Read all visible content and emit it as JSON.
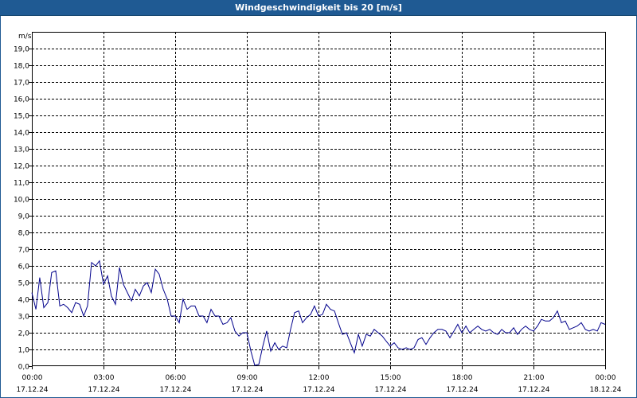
{
  "window": {
    "title": "Windgeschwindigkeit bis 20 [m/s]"
  },
  "chart_data": {
    "type": "line",
    "title": "Windgeschwindigkeit bis 20 [m/s]",
    "ylabel": "m/s",
    "xlabel": "",
    "ylim": [
      0,
      20
    ],
    "xlim_hours": [
      0,
      24
    ],
    "grid": true,
    "y_ticks": [
      "0,0",
      "1,0",
      "2,0",
      "3,0",
      "4,0",
      "5,0",
      "6,0",
      "7,0",
      "8,0",
      "9,0",
      "10,0",
      "11,0",
      "12,0",
      "13,0",
      "14,0",
      "15,0",
      "16,0",
      "17,0",
      "18,0",
      "19,0"
    ],
    "x_ticks": [
      {
        "time": "00:00",
        "date": "17.12.24"
      },
      {
        "time": "03:00",
        "date": "17.12.24"
      },
      {
        "time": "06:00",
        "date": "17.12.24"
      },
      {
        "time": "09:00",
        "date": "17.12.24"
      },
      {
        "time": "12:00",
        "date": "17.12.24"
      },
      {
        "time": "15:00",
        "date": "17.12.24"
      },
      {
        "time": "18:00",
        "date": "17.12.24"
      },
      {
        "time": "21:00",
        "date": "17.12.24"
      },
      {
        "time": "00:00",
        "date": "18.12.24"
      }
    ],
    "series": [
      {
        "color": "#00008b",
        "x_hours": [
          0.0,
          0.17,
          0.33,
          0.5,
          0.67,
          0.83,
          1.0,
          1.17,
          1.33,
          1.5,
          1.67,
          1.83,
          2.0,
          2.17,
          2.33,
          2.5,
          2.67,
          2.83,
          3.0,
          3.17,
          3.33,
          3.5,
          3.67,
          3.83,
          4.0,
          4.17,
          4.33,
          4.5,
          4.67,
          4.83,
          5.0,
          5.17,
          5.33,
          5.5,
          5.67,
          5.83,
          6.0,
          6.17,
          6.33,
          6.5,
          6.67,
          6.83,
          7.0,
          7.17,
          7.33,
          7.5,
          7.67,
          7.83,
          8.0,
          8.17,
          8.33,
          8.5,
          8.67,
          8.83,
          9.0,
          9.17,
          9.33,
          9.5,
          9.67,
          9.83,
          10.0,
          10.17,
          10.33,
          10.5,
          10.67,
          10.83,
          11.0,
          11.17,
          11.33,
          11.5,
          11.67,
          11.83,
          12.0,
          12.17,
          12.33,
          12.5,
          12.67,
          12.83,
          13.0,
          13.17,
          13.33,
          13.5,
          13.67,
          13.83,
          14.0,
          14.17,
          14.33,
          14.5,
          14.67,
          14.83,
          15.0,
          15.17,
          15.33,
          15.5,
          15.67,
          15.83,
          16.0,
          16.17,
          16.33,
          16.5,
          16.67,
          16.83,
          17.0,
          17.17,
          17.33,
          17.5,
          17.67,
          17.83,
          18.0,
          18.17,
          18.33,
          18.5,
          18.67,
          18.83,
          19.0,
          19.17,
          19.33,
          19.5,
          19.67,
          19.83,
          20.0,
          20.17,
          20.33,
          20.5,
          20.67,
          20.83,
          21.0,
          21.17,
          21.33,
          21.5,
          21.67,
          21.83,
          22.0,
          22.17,
          22.33,
          22.5,
          22.67,
          22.83,
          23.0,
          23.17,
          23.33,
          23.5,
          23.67,
          23.83,
          24.0
        ],
        "values": [
          4.4,
          3.4,
          5.3,
          3.5,
          3.8,
          5.6,
          5.7,
          3.6,
          3.7,
          3.5,
          3.2,
          3.8,
          3.7,
          3.0,
          3.6,
          6.2,
          6.0,
          6.3,
          4.9,
          5.4,
          4.2,
          3.7,
          5.9,
          4.9,
          4.4,
          3.9,
          4.6,
          4.2,
          4.8,
          5.0,
          4.4,
          5.8,
          5.5,
          4.6,
          4.0,
          3.0,
          3.0,
          2.6,
          4.0,
          3.4,
          3.6,
          3.6,
          3.0,
          3.0,
          2.6,
          3.4,
          3.0,
          3.0,
          2.5,
          2.6,
          2.9,
          2.1,
          1.8,
          2.0,
          2.0,
          0.9,
          0.05,
          0.1,
          1.2,
          2.1,
          0.9,
          1.4,
          1.0,
          1.2,
          1.1,
          2.2,
          3.2,
          3.3,
          2.6,
          2.9,
          3.1,
          3.6,
          3.0,
          3.1,
          3.7,
          3.4,
          3.3,
          2.6,
          1.9,
          2.0,
          1.4,
          0.8,
          1.9,
          1.2,
          1.9,
          1.8,
          2.2,
          2.0,
          1.8,
          1.5,
          1.2,
          1.4,
          1.1,
          1.0,
          1.1,
          1.0,
          1.1,
          1.6,
          1.7,
          1.3,
          1.7,
          2.0,
          2.2,
          2.2,
          2.1,
          1.7,
          2.1,
          2.5,
          2.0,
          2.4,
          2.0,
          2.2,
          2.4,
          2.2,
          2.1,
          2.2,
          2.0,
          1.9,
          2.2,
          2.0,
          2.0,
          2.3,
          1.9,
          2.2,
          2.4,
          2.2,
          2.1,
          2.4,
          2.8,
          2.7,
          2.7,
          2.9,
          3.3,
          2.6,
          2.7,
          2.2,
          2.3,
          2.4,
          2.6,
          2.2,
          2.1,
          2.2,
          2.1,
          2.6,
          2.5,
          2.6,
          2.5,
          2.9,
          2.9
        ]
      }
    ]
  }
}
